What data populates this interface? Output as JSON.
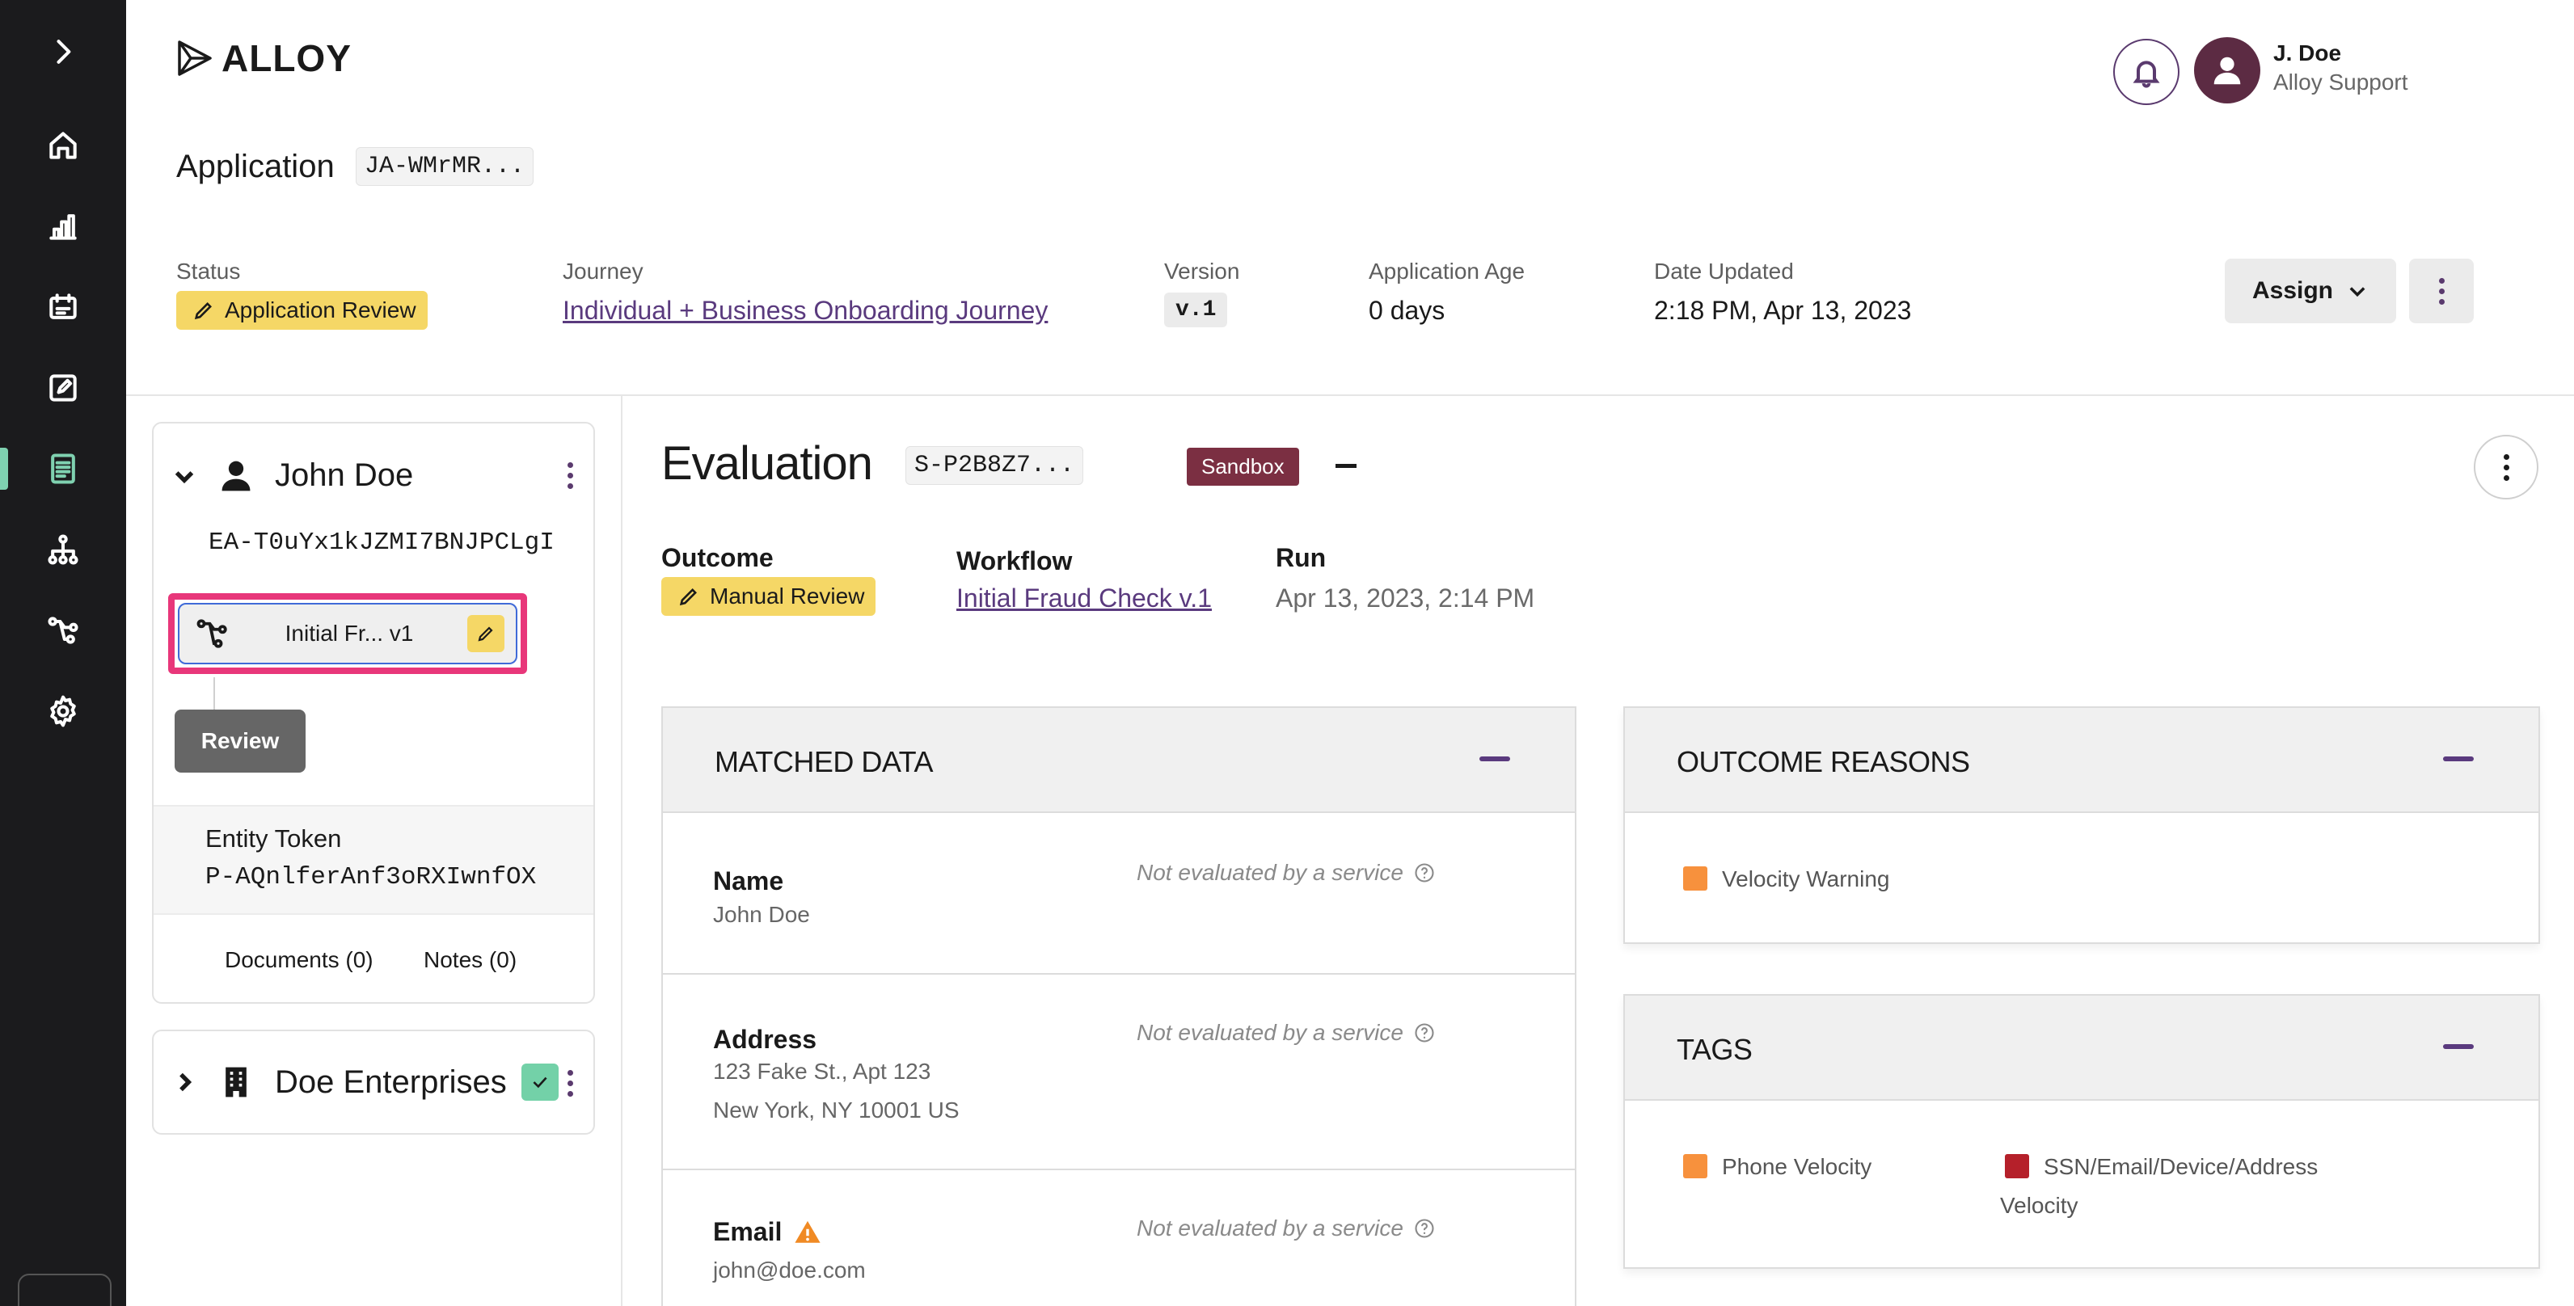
{
  "brand": {
    "name": "ALLOY"
  },
  "user": {
    "name": "J. Doe",
    "role": "Alloy Support"
  },
  "application": {
    "title": "Application",
    "id": "JA-WMrMR...",
    "status_label": "Status",
    "status": "Application Review",
    "journey_label": "Journey",
    "journey": "Individual + Business Onboarding Journey",
    "version_label": "Version",
    "version": "v.1",
    "age_label": "Application Age",
    "age": "0 days",
    "updated_label": "Date Updated",
    "updated": "2:18 PM, Apr 13, 2023",
    "assign_label": "Assign"
  },
  "entity": {
    "name": "John Doe",
    "token_top": "EA-T0uYx1kJZMI7BNJPCLgI",
    "workflow_node": "Initial Fr... v1",
    "review_button": "Review",
    "token_label": "Entity Token",
    "token_value": "P-AQnlferAnf3oRXIwnfOX",
    "documents": "Documents (0)",
    "notes": "Notes (0)"
  },
  "business": {
    "name": "Doe Enterprises"
  },
  "evaluation": {
    "title": "Evaluation",
    "id": "S-P2B8Z7...",
    "environment": "Sandbox",
    "outcome_label": "Outcome",
    "outcome": "Manual Review",
    "workflow_label": "Workflow",
    "workflow": "Initial Fraud Check v.1",
    "run_label": "Run",
    "run": "Apr 13, 2023, 2:14 PM"
  },
  "matched_data": {
    "title": "MATCHED DATA",
    "rows": [
      {
        "label": "Name",
        "value_lines": [
          "John Doe"
        ],
        "note": "Not evaluated by a service"
      },
      {
        "label": "Address",
        "value_lines": [
          "123 Fake St., Apt 123",
          "New York, NY 10001 US"
        ],
        "note": "Not evaluated by a service"
      },
      {
        "label": "Email",
        "value_lines": [
          "john@doe.com"
        ],
        "note": "Not evaluated by a service"
      }
    ]
  },
  "outcome_reasons": {
    "title": "OUTCOME REASONS",
    "items": [
      {
        "label": "Velocity Warning",
        "color": "#f7913d"
      }
    ]
  },
  "tags": {
    "title": "TAGS",
    "items": [
      {
        "label": "Phone Velocity",
        "color": "#f7913d"
      },
      {
        "label_line1": "SSN/Email/Device/Address",
        "label_line2": "Velocity",
        "color": "#b5202a"
      }
    ]
  },
  "colors": {
    "accent": "#5a3a7e",
    "status_yellow": "#f5d766",
    "sandbox": "#7b2f42",
    "sidebar_active": "#7fd1b0"
  },
  "sidebar_icons": [
    "chevron-right-icon",
    "home-icon",
    "bar-chart-icon",
    "inbox-icon",
    "edit-icon",
    "document-icon",
    "hierarchy-icon",
    "workflow-icon",
    "gear-icon"
  ]
}
